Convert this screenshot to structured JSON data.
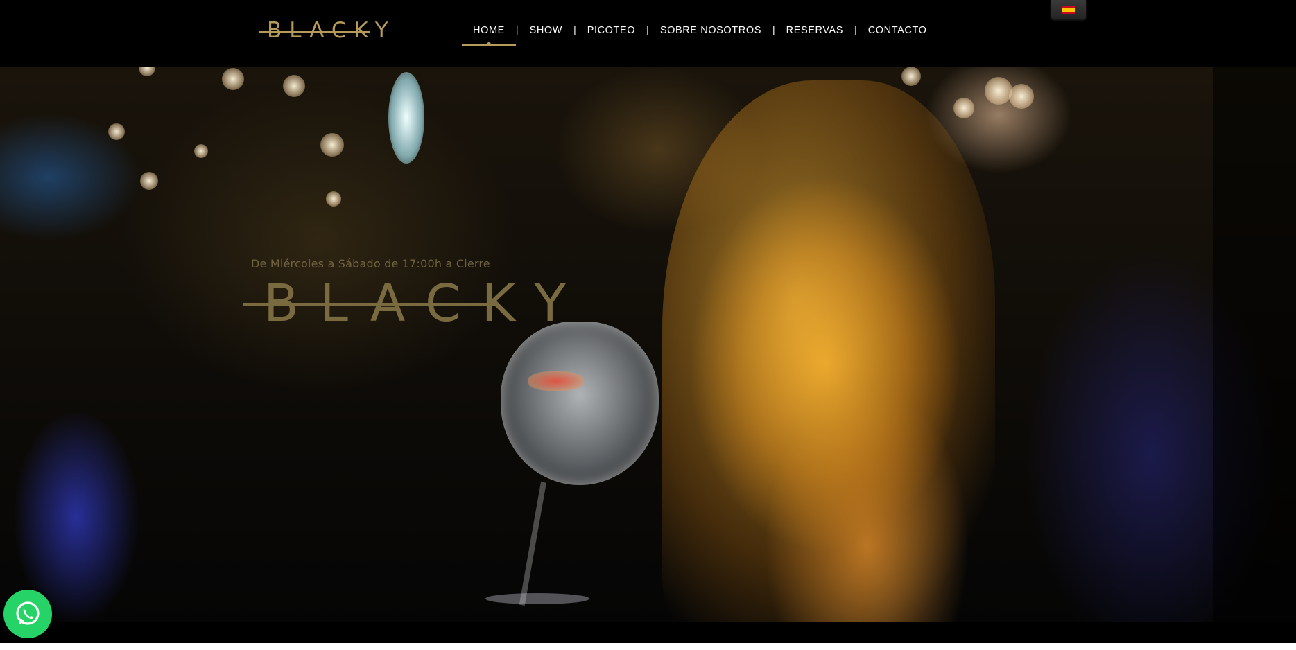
{
  "brand": {
    "logo_text": "BLACKY"
  },
  "nav": {
    "items": [
      {
        "label": "HOME",
        "active": true
      },
      {
        "label": "SHOW"
      },
      {
        "label": "PICOTEO"
      },
      {
        "label": "SOBRE NOSOTROS"
      },
      {
        "label": "RESERVAS"
      },
      {
        "label": "CONTACTO"
      }
    ],
    "separator": "|"
  },
  "language": {
    "flag_icon": "spain-flag-icon"
  },
  "hero": {
    "schedule": "De Miércoles a Sábado de 17:00h a Cierre",
    "logo_text": "BLACKY"
  },
  "whatsapp": {
    "icon": "whatsapp-icon",
    "color": "#25d366"
  },
  "colors": {
    "accent": "#b59a5a",
    "background": "#000000"
  }
}
